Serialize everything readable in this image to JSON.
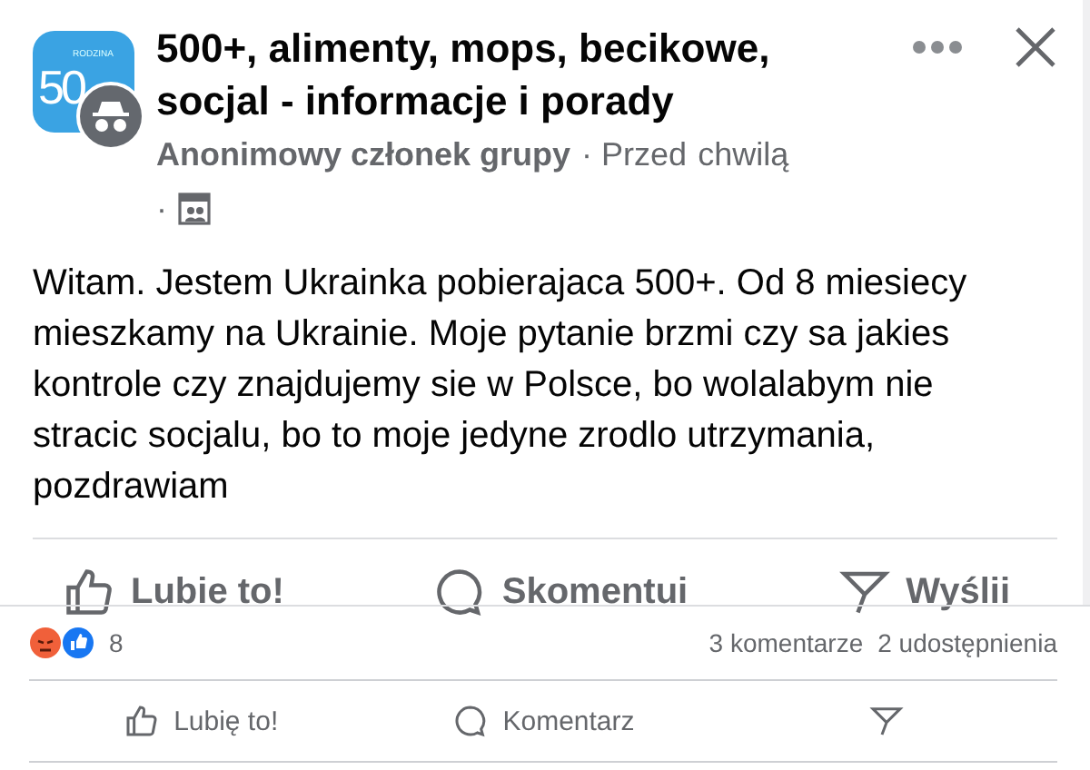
{
  "post": {
    "logo": {
      "number": "50",
      "caption": "RODZINA"
    },
    "group": "500+, alimenty, mops, becikowe, socjal - informacje i porady",
    "author": "Anonimowy członek grupy",
    "time_prefix": "· Przed",
    "time": "chwilą",
    "time_dot": "·",
    "body": "Witam. Jestem Ukrainka pobierajaca 500+. Od 8 miesiecy mieszkamy na Ukrainie. Moje pytanie brzmi czy sa jakies kontrole czy znajdujemy sie w Polsce, bo wolalabym nie stracic socjalu, bo to moje jedyne zrodlo utrzymania, pozdrawiam",
    "actions": [
      {
        "kind": "like",
        "label": "Lubie to!"
      },
      {
        "kind": "comment",
        "label": "Skomentui"
      },
      {
        "kind": "share",
        "label": "Wyślii"
      }
    ]
  },
  "footer": {
    "reaction_count": "8",
    "comments": "3 komentarze",
    "shares": "2 udostępnienia",
    "actions": [
      {
        "kind": "like",
        "label": "Lubię to!"
      },
      {
        "kind": "comment",
        "label": "Komentarz"
      },
      {
        "kind": "share"
      }
    ]
  }
}
